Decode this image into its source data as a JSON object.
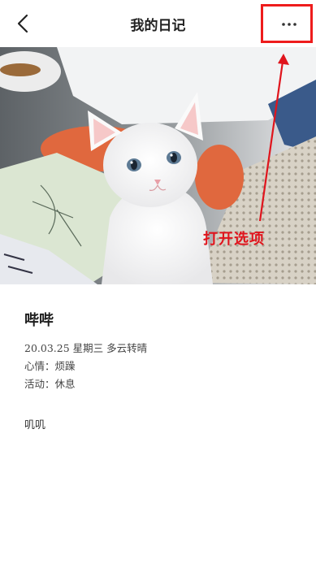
{
  "header": {
    "title": "我的日记",
    "back_icon": "chevron-left-icon",
    "more_icon": "more-horizontal-icon"
  },
  "image": {
    "description_icon": "white-kitten-photo"
  },
  "annotation": {
    "text": "打开选项",
    "color": "#e0141c"
  },
  "entry": {
    "title": "哔哔",
    "date_weather": "20.03.25 星期三 多云转晴",
    "mood": "心情：烦躁",
    "activity": "活动：休息",
    "content": "叽叽"
  }
}
